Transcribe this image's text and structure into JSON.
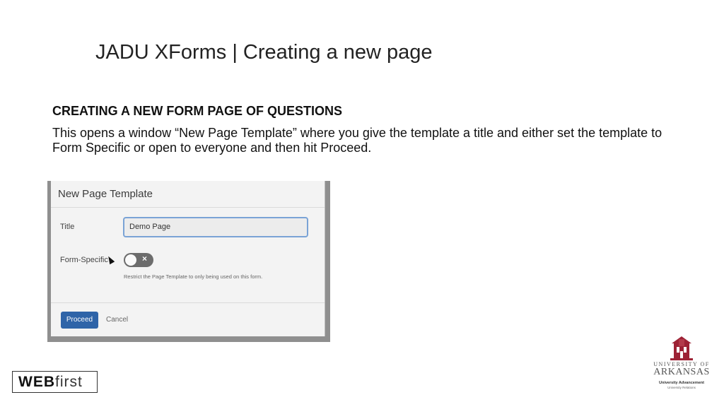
{
  "slide": {
    "title": "JADU XForms | Creating a new page",
    "heading": "CREATING A NEW FORM PAGE OF QUESTIONS",
    "body": "This opens a window “New Page Template” where you give the template a title and either set the template to Form Specific or open to everyone and then hit Proceed."
  },
  "dialog": {
    "title": "New Page Template",
    "title_label": "Title",
    "title_value": "Demo Page",
    "form_specific_label": "Form-Specific",
    "form_specific_enabled": false,
    "toggle_glyph": "×",
    "help_text": "Restrict the Page Template to only being used on this form.",
    "proceed_label": "Proceed",
    "cancel_label": "Cancel",
    "colors": {
      "primary": "#2f64a8",
      "focus_border": "#7aa3d6"
    }
  },
  "logos": {
    "webfirst_bold": "WEB",
    "webfirst_light": "first",
    "ua_line1": "UNIVERSITY OF",
    "ua_line2": "ARKANSAS",
    "ua_line3": "University Advancement",
    "ua_line4": "University Relations",
    "ua_color": "#9d2235"
  }
}
